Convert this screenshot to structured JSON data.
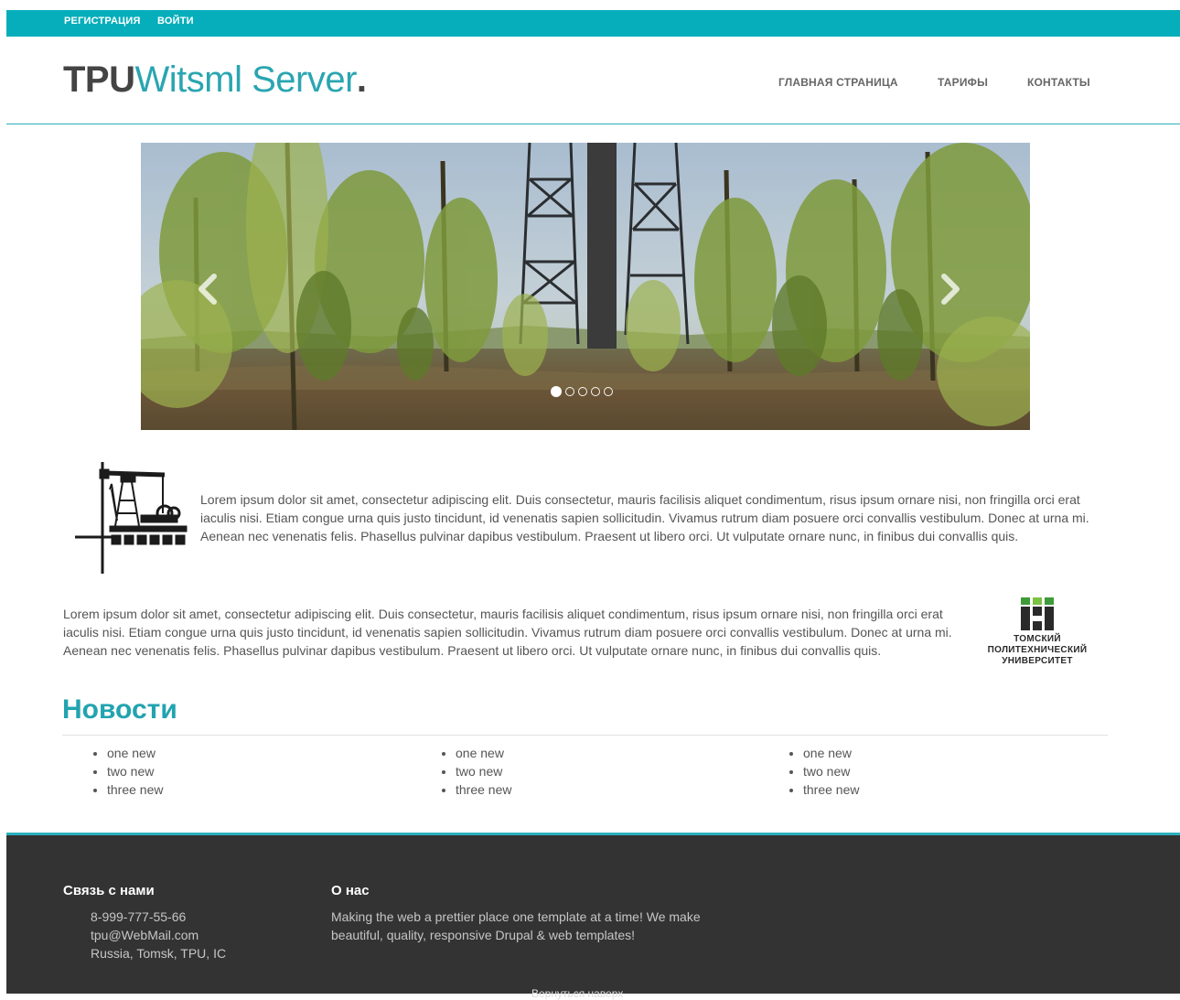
{
  "topbar": {
    "register": "РЕГИСТРАЦИЯ",
    "login": "ВОЙТИ"
  },
  "logo": {
    "part1": "TPU",
    "part2": "Witsml Server",
    "part3": "."
  },
  "nav": {
    "home": "ГЛАВНАЯ СТРАНИЦА",
    "tariffs": "ТАРИФЫ",
    "contacts": "КОНТАКТЫ"
  },
  "slider": {
    "slide_count": 5,
    "active_index": 0
  },
  "intro": {
    "text1": "Lorem ipsum dolor sit amet, consectetur adipiscing elit. Duis consectetur, mauris facilisis aliquet condimentum, risus ipsum ornare nisi, non fringilla orci erat iaculis nisi. Etiam congue urna quis justo tincidunt, id venenatis sapien sollicitudin. Vivamus rutrum diam posuere orci convallis vestibulum. Donec at urna mi. Aenean nec venenatis felis. Phasellus pulvinar dapibus vestibulum. Praesent ut libero orci. Ut vulputate ornare nunc, in finibus dui convallis quis.",
    "text2": "Lorem ipsum dolor sit amet, consectetur adipiscing elit. Duis consectetur, mauris facilisis aliquet condimentum, risus ipsum ornare nisi, non fringilla orci erat iaculis nisi. Etiam congue urna quis justo tincidunt, id venenatis sapien sollicitudin. Vivamus rutrum diam posuere orci convallis vestibulum. Donec at urna mi. Aenean nec venenatis felis. Phasellus pulvinar dapibus vestibulum. Praesent ut libero orci. Ut vulputate ornare nunc, in finibus dui convallis quis."
  },
  "university_logo": {
    "line1": "ТОМСКИЙ",
    "line2": "ПОЛИТЕХНИЧЕСКИЙ",
    "line3": "УНИВЕРСИТЕТ"
  },
  "news": {
    "title": "Новости",
    "columns": [
      [
        "one new",
        "two new",
        "three new"
      ],
      [
        "one new",
        "two new",
        "three new"
      ],
      [
        "one new",
        "two new",
        "three new"
      ]
    ]
  },
  "footer": {
    "contact_title": "Связь с нами",
    "phone": "8-999-777-55-66",
    "email": "tpu@WebMail.com",
    "address": "Russia, Tomsk, TPU, IC",
    "about_title": "О нас",
    "about_line1": "Making the web a prettier place one template at a time! We make",
    "about_line2": "beautiful, quality, responsive Drupal & web templates!",
    "back_to_top": "Вернуться наверх"
  },
  "colors": {
    "accent": "#06aebb",
    "logo_accent": "#2aa5b1",
    "footer_bg": "#333333"
  }
}
